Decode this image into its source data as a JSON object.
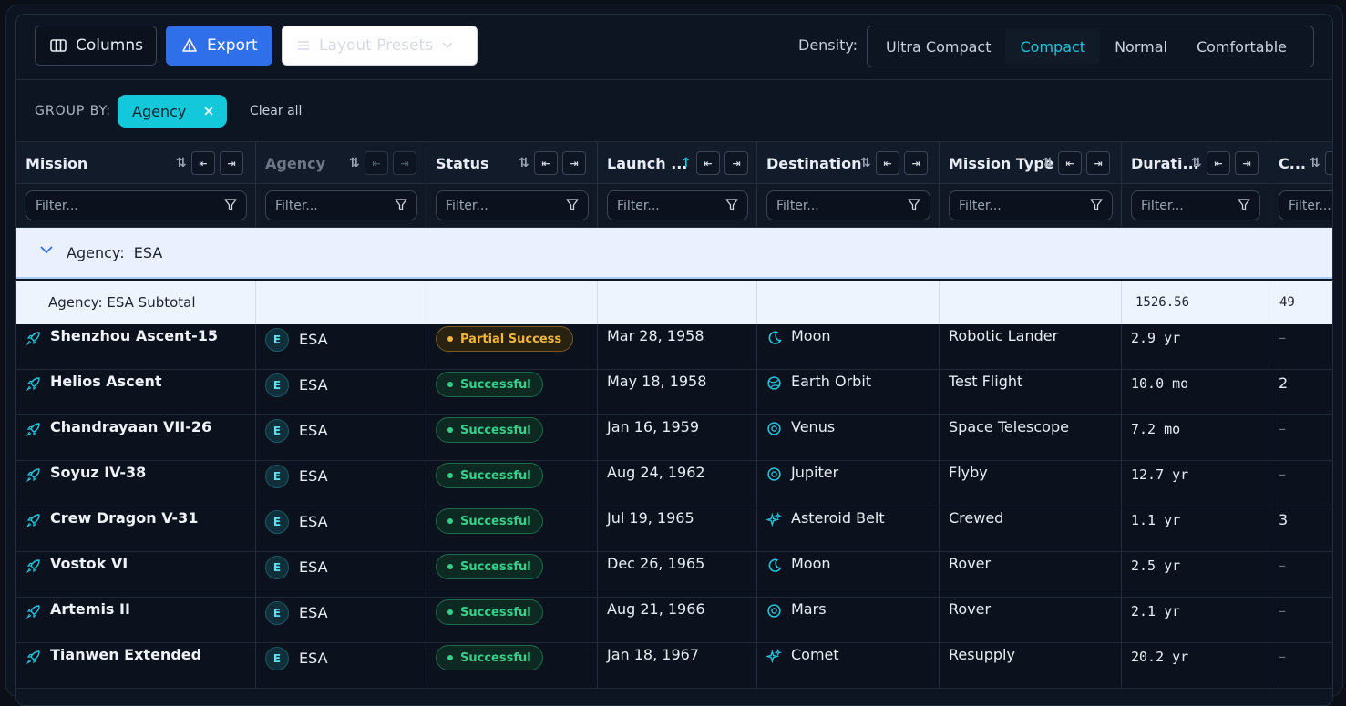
{
  "toolbar": {
    "columns_label": "Columns",
    "export_label": "Export",
    "presets_label": "Layout Presets",
    "density_label": "Density:",
    "density_options": [
      "Ultra Compact",
      "Compact",
      "Normal",
      "Comfortable"
    ],
    "density_selected": "Compact"
  },
  "group_by": {
    "label": "GROUP BY:",
    "chip": "Agency",
    "clear": "Clear all"
  },
  "columns": [
    "Mission",
    "Agency",
    "Status",
    "Launch ...",
    "Destination",
    "Mission Type",
    "Durati...",
    "C..."
  ],
  "filter_placeholder": "Filter...",
  "group": {
    "label": "Agency:",
    "value": "ESA",
    "subtotal_label": "Agency: ESA Subtotal",
    "subtotal_duration": "1526.56",
    "subtotal_crew": "49"
  },
  "rows": [
    {
      "mission": "Shenzhou Ascent-15",
      "agency_initial": "E",
      "agency": "ESA",
      "status": "Partial Success",
      "launch": "Mar 28, 1958",
      "destination": "Moon",
      "mission_type": "Robotic Lander",
      "duration": "2.9 yr",
      "crew": "–"
    },
    {
      "mission": "Helios Ascent",
      "agency_initial": "E",
      "agency": "ESA",
      "status": "Successful",
      "launch": "May 18, 1958",
      "destination": "Earth Orbit",
      "mission_type": "Test Flight",
      "duration": "10.0 mo",
      "crew": "2"
    },
    {
      "mission": "Chandrayaan VII-26",
      "agency_initial": "E",
      "agency": "ESA",
      "status": "Successful",
      "launch": "Jan 16, 1959",
      "destination": "Venus",
      "mission_type": "Space Telescope",
      "duration": "7.2 mo",
      "crew": "–"
    },
    {
      "mission": "Soyuz IV-38",
      "agency_initial": "E",
      "agency": "ESA",
      "status": "Successful",
      "launch": "Aug 24, 1962",
      "destination": "Jupiter",
      "mission_type": "Flyby",
      "duration": "12.7 yr",
      "crew": "–"
    },
    {
      "mission": "Crew Dragon V-31",
      "agency_initial": "E",
      "agency": "ESA",
      "status": "Successful",
      "launch": "Jul 19, 1965",
      "destination": "Asteroid Belt",
      "mission_type": "Crewed",
      "duration": "1.1 yr",
      "crew": "3"
    },
    {
      "mission": "Vostok VI",
      "agency_initial": "E",
      "agency": "ESA",
      "status": "Successful",
      "launch": "Dec 26, 1965",
      "destination": "Moon",
      "mission_type": "Rover",
      "duration": "2.5 yr",
      "crew": "–"
    },
    {
      "mission": "Artemis II",
      "agency_initial": "E",
      "agency": "ESA",
      "status": "Successful",
      "launch": "Aug 21, 1966",
      "destination": "Mars",
      "mission_type": "Rover",
      "duration": "2.1 yr",
      "crew": "–"
    },
    {
      "mission": "Tianwen Extended",
      "agency_initial": "E",
      "agency": "ESA",
      "status": "Successful",
      "launch": "Jan 18, 1967",
      "destination": "Comet",
      "mission_type": "Resupply",
      "duration": "20.2 yr",
      "crew": "–"
    }
  ],
  "colors": {
    "accent": "#22c4dc",
    "export": "#2f6fea",
    "success": "#35d08a",
    "partial": "#f2b63c"
  }
}
